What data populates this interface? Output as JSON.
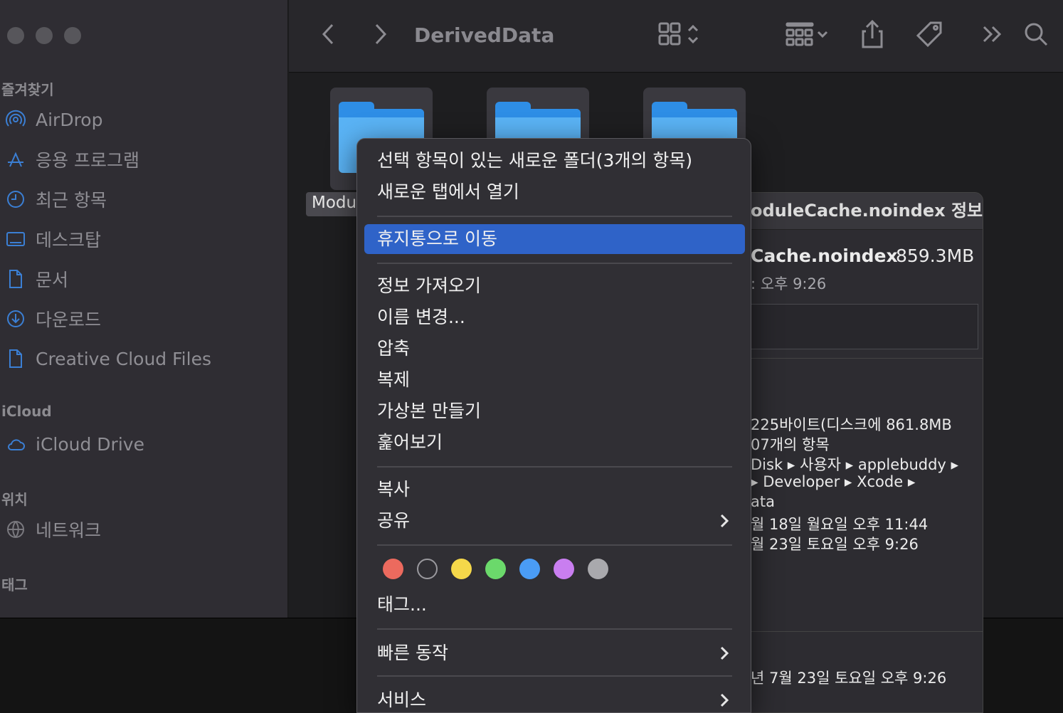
{
  "window": {
    "title": "DerivedData"
  },
  "sidebar": {
    "sections": [
      {
        "label": "즐겨찾기"
      },
      {
        "label": "iCloud"
      },
      {
        "label": "위치"
      },
      {
        "label": "태그"
      }
    ],
    "favorites": [
      {
        "label": "AirDrop",
        "icon": "airdrop-icon"
      },
      {
        "label": "응용 프로그램",
        "icon": "applications-icon"
      },
      {
        "label": "최근 항목",
        "icon": "recents-icon"
      },
      {
        "label": "데스크탑",
        "icon": "desktop-icon"
      },
      {
        "label": "문서",
        "icon": "document-icon"
      },
      {
        "label": "다운로드",
        "icon": "downloads-icon"
      },
      {
        "label": "Creative Cloud Files",
        "icon": "file-icon"
      }
    ],
    "icloud": [
      {
        "label": "iCloud Drive",
        "icon": "cloud-icon"
      }
    ],
    "locations": [
      {
        "label": "네트워크",
        "icon": "network-icon"
      }
    ]
  },
  "content": {
    "selected_label": "Modu"
  },
  "context_menu": {
    "items": [
      {
        "label": "선택 항목이 있는 새로운 폴더(3개의 항목)"
      },
      {
        "label": "새로운 탭에서 열기"
      },
      {
        "label": "휴지통으로 이동",
        "highlighted": true
      },
      {
        "label": "정보 가져오기"
      },
      {
        "label": "이름 변경..."
      },
      {
        "label": "압축"
      },
      {
        "label": "복제"
      },
      {
        "label": "가상본 만들기"
      },
      {
        "label": "훑어보기"
      },
      {
        "label": "복사"
      },
      {
        "label": "공유",
        "submenu": true
      },
      {
        "label": "태그..."
      },
      {
        "label": "빠른 동작",
        "submenu": true
      },
      {
        "label": "서비스",
        "submenu": true
      }
    ],
    "tag_colors": [
      "#ec6a5e",
      "none",
      "#f5d84a",
      "#6bd96b",
      "#4a9cf5",
      "#c97ef0",
      "#a9a9ad"
    ]
  },
  "info_window": {
    "title": "oduleCache.noindex 정보",
    "name": "Cache.noindex",
    "size": "859.3MB",
    "modified_short": ": 오후 9:26",
    "details": [
      "225바이트(디스크에 861.8MB",
      "07개의 항목",
      "Disk ▸ 사용자 ▸ applebuddy ▸",
      "▸ Developer ▸ Xcode ▸",
      "ata",
      "월 18일 월요일 오후 11:44",
      "월 23일 토요일 오후 9:26"
    ],
    "footer": "년 7월 23일 토요일 오후 9:26"
  }
}
